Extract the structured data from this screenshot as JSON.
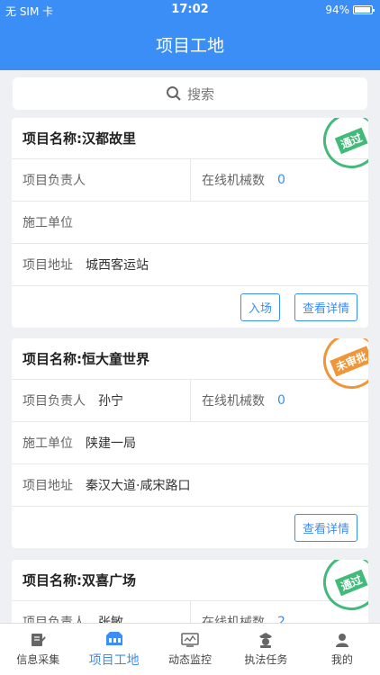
{
  "status_bar": {
    "carrier": "无 SIM 卡",
    "time": "17:02",
    "battery": "94%"
  },
  "nav": {
    "title": "项目工地"
  },
  "search": {
    "placeholder": "搜索"
  },
  "labels": {
    "manager": "项目负责人",
    "machines": "在线机械数",
    "construction_unit": "施工单位",
    "address": "项目地址",
    "enter": "入场",
    "details": "查看详情"
  },
  "projects": [
    {
      "title": "项目名称:汉都故里",
      "manager": "",
      "machines": "0",
      "unit": "",
      "address": "城西客运站",
      "stamp": "通过",
      "stamp_color": "#2eb36b"
    },
    {
      "title": "项目名称:恒大童世界",
      "manager": "孙宁",
      "machines": "0",
      "unit": "陕建一局",
      "address": "秦汉大道·咸宋路口",
      "stamp": "未审批",
      "stamp_color": "#f08a24"
    },
    {
      "title": "项目名称:双喜广场",
      "manager": "张敏",
      "machines": "2",
      "unit": "",
      "address": "",
      "stamp": "通过",
      "stamp_color": "#2eb36b"
    }
  ],
  "tabs": [
    {
      "label": "信息采集",
      "icon": "edit-icon"
    },
    {
      "label": "项目工地",
      "icon": "site-icon"
    },
    {
      "label": "动态监控",
      "icon": "monitor-icon"
    },
    {
      "label": "执法任务",
      "icon": "officer-icon"
    },
    {
      "label": "我的",
      "icon": "user-icon"
    }
  ],
  "colors": {
    "primary": "#3a8ef6",
    "approved": "#2eb36b",
    "pending": "#f08a24"
  }
}
